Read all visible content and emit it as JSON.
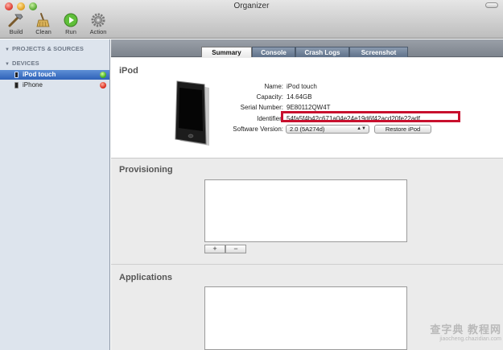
{
  "window": {
    "title": "Organizer"
  },
  "toolbar": {
    "items": [
      {
        "label": "Build",
        "icon": "hammer-icon"
      },
      {
        "label": "Clean",
        "icon": "broom-icon"
      },
      {
        "label": "Run",
        "icon": "play-icon"
      },
      {
        "label": "Action",
        "icon": "gear-icon"
      }
    ]
  },
  "sidebar": {
    "groups": [
      {
        "label": "PROJECTS & SOURCES"
      },
      {
        "label": "DEVICES"
      }
    ],
    "devices": [
      {
        "label": "iPod touch",
        "status": "green",
        "selected": true
      },
      {
        "label": "iPhone",
        "status": "red",
        "selected": false
      }
    ]
  },
  "tabs": [
    {
      "label": "Summary",
      "active": true
    },
    {
      "label": "Console",
      "active": false
    },
    {
      "label": "Crash Logs",
      "active": false
    },
    {
      "label": "Screenshot",
      "active": false
    }
  ],
  "summary": {
    "device_title": "iPod",
    "fields": {
      "name": {
        "label": "Name:",
        "value": "iPod touch"
      },
      "capacity": {
        "label": "Capacity:",
        "value": "14.64GB"
      },
      "serial": {
        "label": "Serial Number:",
        "value": "9E80112QW4T"
      },
      "identifier": {
        "label": "Identifier:",
        "value": "54fa5f4b42c671a04e24e19d6f42acd20fe22adf"
      },
      "software": {
        "label": "Software Version:",
        "value": "2.0 (5A274d)"
      }
    },
    "restore_label": "Restore iPod"
  },
  "provisioning": {
    "title": "Provisioning",
    "add_label": "+",
    "remove_label": "−"
  },
  "applications": {
    "title": "Applications"
  },
  "watermark": {
    "line1": "查字典 教程网",
    "line2": "jiaocheng.chazidian.com"
  },
  "colors": {
    "highlight": "#c8102e",
    "selection": "#2f62b8",
    "sidebar": "#dde4ed",
    "status_green": "#3fae1e",
    "status_red": "#d92a1c"
  }
}
